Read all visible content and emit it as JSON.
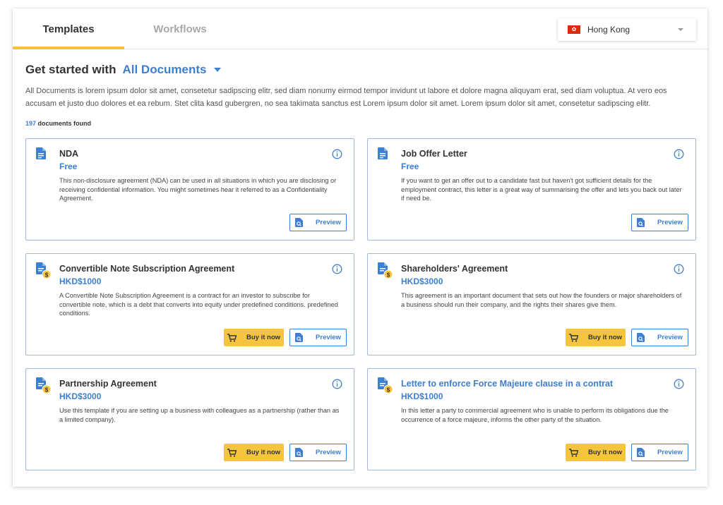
{
  "tabs": [
    {
      "label": "Templates",
      "active": true
    },
    {
      "label": "Workflows",
      "active": false
    }
  ],
  "region": {
    "label": "Hong Kong",
    "flag_symbol": "✿"
  },
  "heading": {
    "prefix": "Get started with",
    "category": "All Documents"
  },
  "intro": "All Documents is lorem ipsum dolor sit amet, consetetur sadipscing elitr, sed diam nonumy eirmod tempor invidunt ut labore et dolore magna aliquyam erat, sed diam voluptua. At vero eos accusam et justo duo dolores et ea rebum. Stet clita kasd gubergren, no sea takimata sanctus est Lorem ipsum dolor sit amet. Lorem ipsum dolor sit amet, consetetur sadipscing elitr.",
  "count": {
    "number": "197",
    "label": "documents found"
  },
  "buttons": {
    "preview": "Preview",
    "buy": "Buy it now"
  },
  "colors": {
    "accent": "#3d7fd0",
    "buy": "#f6c53f",
    "tab_underline": "#f3c23a",
    "flag": "#de2910"
  },
  "cards": [
    {
      "title": "NDA",
      "price": "Free",
      "paid": false,
      "description": "This non-disclosure agreement (NDA) can be used in all situations in which you are disclosing or receiving confidential information. You might sometimes hear it referred to as a Confidentiality Agreement.",
      "icon": "document-icon"
    },
    {
      "title": "Job Offer Letter",
      "price": "Free",
      "paid": false,
      "description": "If you want to get an offer out to a candidate fast but haven't got sufficient details for the employment contract, this letter is a great way of summarising the offer and lets you back out later if need be.",
      "icon": "document-icon"
    },
    {
      "title": "Convertible Note Subscription Agreement",
      "price": "HKD$1000",
      "paid": true,
      "description": "A Convertible Note Subscription Agreement is a contract for an investor to subscribe for convertible note, which is a debt that converts into equity under predefined conditions. predefined conditions.",
      "icon": "paid-document-icon"
    },
    {
      "title": "Shareholders' Agreement",
      "price": "HKD$3000",
      "paid": true,
      "description": "This agreement is an important document that sets out how the founders or major shareholders of a business should run their company, and the rights their shares give them.",
      "icon": "paid-document-icon"
    },
    {
      "title": "Partnership Agreement",
      "price": "HKD$3000",
      "paid": true,
      "description": "Use this template if you are setting up a business with colleagues as a partnership (rather than as a limited company).",
      "icon": "paid-document-icon"
    },
    {
      "title": "Letter to enforce Force Majeure clause in a contrat",
      "price": "HKD$1000",
      "paid": true,
      "title_link": true,
      "description": "In this letter a party to commercial agreement who is unable to perform its obligations due the occurrence of a force majeure, informs the other party of the situation.",
      "icon": "paid-document-icon"
    }
  ]
}
